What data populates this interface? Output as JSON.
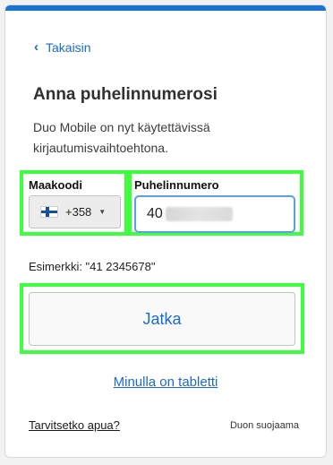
{
  "nav": {
    "back_label": "Takaisin",
    "back_icon": "chevron-left-icon"
  },
  "heading": {
    "title": "Anna puhelinnumerosi",
    "subtitle": "Duo Mobile on nyt käytettävissä kirjautumisvaihtoehtona."
  },
  "form": {
    "country_label": "Maakoodi",
    "country_code": "+358",
    "country_flag": "finland-flag-icon",
    "phone_label": "Puhelinnumero",
    "phone_visible_prefix": "40",
    "example": "Esimerkki: \"41 2345678\""
  },
  "actions": {
    "continue_label": "Jatka",
    "tablet_link": "Minulla on tabletti"
  },
  "footer": {
    "help_link": "Tarvitsetko apua?",
    "secured_by": "Duon suojaama"
  },
  "colors": {
    "accent": "#1a6ad1",
    "top_bar": "#1a73cf",
    "highlight": "#3dff3d"
  }
}
